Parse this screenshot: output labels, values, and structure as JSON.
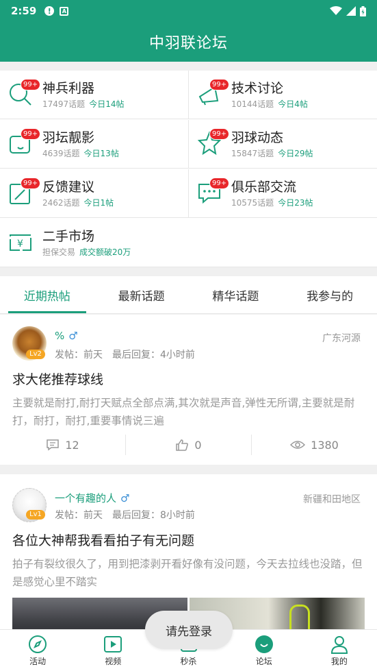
{
  "status_bar": {
    "time": "2:59",
    "icons": [
      "alert-icon",
      "sim-icon",
      "wifi-icon",
      "signal-icon",
      "battery-icon"
    ]
  },
  "app": {
    "title": "中羽联论坛",
    "accent": "#1b9e7b",
    "badge_color": "#e8262a"
  },
  "forums": [
    {
      "name": "神兵利器",
      "topics": "17497话题",
      "today": "今日14帖",
      "badge": "99+",
      "icon": "search-icon"
    },
    {
      "name": "技术讨论",
      "topics": "10144话题",
      "today": "今日4帖",
      "badge": "99+",
      "icon": "megaphone-icon"
    },
    {
      "name": "羽坛靓影",
      "topics": "4639话题",
      "today": "今日13帖",
      "badge": "99+",
      "icon": "camera-icon"
    },
    {
      "name": "羽球动态",
      "topics": "15847话题",
      "today": "今日29帖",
      "badge": "99+",
      "icon": "star-icon"
    },
    {
      "name": "反馈建议",
      "topics": "2462话题",
      "today": "今日1帖",
      "badge": "99+",
      "icon": "edit-icon"
    },
    {
      "name": "俱乐部交流",
      "topics": "10575话题",
      "today": "今日23帖",
      "badge": "99+",
      "icon": "chat-icon"
    },
    {
      "name": "二手市场",
      "topics": "担保交易",
      "today": "成交额破20万",
      "badge": "",
      "icon": "money-icon"
    }
  ],
  "tabs": [
    "近期热帖",
    "最新话题",
    "精华话题",
    "我参与的"
  ],
  "posts": [
    {
      "username": "%",
      "gender": "♂",
      "level": "Lv2",
      "location": "广东河源",
      "posted": "发帖：前天",
      "last_reply": "最后回复：4小时前",
      "title": "求大佬推荐球线",
      "body": "主要就是耐打,耐打天赋点全部点满,其次就是声音,弹性无所谓,主要就是耐打，耐打，耐打,重要事情说三遍",
      "comments": "12",
      "likes": "0",
      "views": "1380"
    },
    {
      "username": "一个有趣的人",
      "gender": "♂",
      "level": "Lv1",
      "location": "新疆和田地区",
      "posted": "发帖：前天",
      "last_reply": "最后回复：8小时前",
      "title": "各位大神帮我看看拍子有无问题",
      "body": "拍子有裂纹很久了，用到把漆剥开看好像有没问题，今天去拉线也没踏，但是感觉心里不踏实"
    }
  ],
  "toast": "请先登录",
  "bottom_nav": [
    {
      "label": "活动",
      "icon": "compass-icon"
    },
    {
      "label": "视频",
      "icon": "video-icon"
    },
    {
      "label": "秒杀",
      "icon": "flash-sale-icon"
    },
    {
      "label": "论坛",
      "icon": "forum-icon"
    },
    {
      "label": "我的",
      "icon": "user-icon"
    }
  ]
}
